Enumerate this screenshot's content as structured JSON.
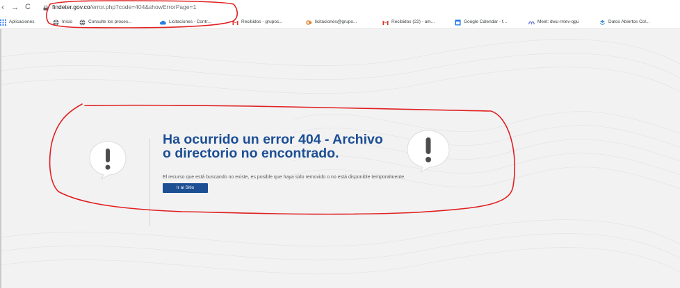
{
  "browser": {
    "url_domain": "findeter.gov.co",
    "url_path": "/error.php?code=404&showErrorPage=1",
    "nav": {
      "back": "‹",
      "forward": "→",
      "reload": "C"
    }
  },
  "bookmarks": [
    {
      "label": "Aplicaciones",
      "icon": "apps-grid-icon",
      "color": "#4285f4"
    },
    {
      "label": "Inicio",
      "icon": "globe-icon",
      "color": "#5f6368"
    },
    {
      "label": "Consulte los proces...",
      "icon": "globe-icon",
      "color": "#5f6368"
    },
    {
      "label": "Licitaciones - Contr...",
      "icon": "cloud-icon",
      "color": "#2a7de1"
    },
    {
      "label": "Recibidos - grupoc...",
      "icon": "gmail-icon",
      "color": "#d93025"
    },
    {
      "label": "licitaciones@grupo...",
      "icon": "mail-link-icon",
      "color": "#e07a1f"
    },
    {
      "label": "Recibidos (22) - am...",
      "icon": "gmail-icon",
      "color": "#d93025"
    },
    {
      "label": "Google Calendar - f...",
      "icon": "calendar-icon",
      "color": "#1a73e8"
    },
    {
      "label": "Meet: dwu-rmev-qgu",
      "icon": "meet-icon",
      "color": "#6a7ad8"
    },
    {
      "label": "Datos Abiertos Col...",
      "icon": "data-icon",
      "color": "#3f8fd6"
    }
  ],
  "error": {
    "title_line1": "Ha ocurrido un error 404 - Archivo",
    "title_line2": "o directorio no encontrado.",
    "description": "El recurso que está buscando no existe, es posible que haya sido removido o no está disponible temporalmente.",
    "button_label": "Ir al Sitio"
  },
  "colors": {
    "title": "#1c4e94",
    "button": "#1c4e94",
    "page_background": "#f2f2f3",
    "annotation": "#e02020"
  }
}
